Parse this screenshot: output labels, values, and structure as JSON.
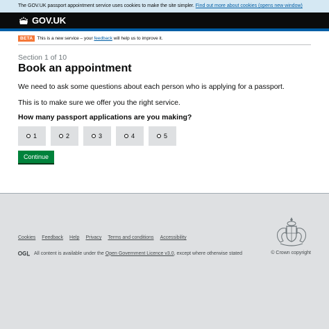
{
  "cookie_bar": {
    "text": "The GOV.UK passport appointment service uses cookies to make the site simpler.",
    "link": "Find out more about cookies (opens new window)"
  },
  "header": {
    "logo_text": "GOV.UK"
  },
  "beta": {
    "tag": "BETA",
    "text_before": "This is a new service – your",
    "link": "feedback",
    "text_after": "will help us to improve it."
  },
  "main": {
    "caption": "Section 1 of 10",
    "title": "Book an appointment",
    "para1": "We need to ask some questions about each person who is applying for a passport.",
    "para2": "This is to make sure we offer you the right service.",
    "question": "How many passport applications are you making?",
    "options": [
      "1",
      "2",
      "3",
      "4",
      "5"
    ],
    "continue_label": "Continue"
  },
  "footer": {
    "links": [
      "Cookies",
      "Feedback",
      "Help",
      "Privacy",
      "Terms and conditions",
      "Accessibility"
    ],
    "licence_before": "All content is available under the",
    "licence_link": "Open Government Licence v3.0",
    "licence_after": ", except where otherwise stated",
    "copyright": "© Crown copyright"
  },
  "colors": {
    "header_bg": "#0b0c0c",
    "link": "#005ea5",
    "beta_tag": "#f47738",
    "continue_button": "#00823b",
    "cookie_bar_bg": "#d5e8f3"
  }
}
